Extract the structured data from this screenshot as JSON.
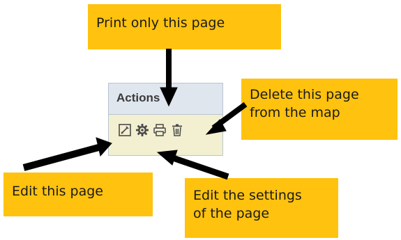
{
  "panel": {
    "header": "Actions",
    "icons": [
      "edit-page-icon",
      "settings-gear-icon",
      "print-icon",
      "trash-icon"
    ]
  },
  "callouts": {
    "print": "Print only this page",
    "delete_line1": "Delete this page",
    "delete_line2": "from the map",
    "edit": "Edit this page",
    "settings_line1": "Edit the settings",
    "settings_line2": "of the page"
  },
  "colors": {
    "callout_bg": "#ffc20e",
    "panel_header_bg": "#dfe6ee",
    "panel_body_bg": "#f3f0d1",
    "arrow": "#000000"
  }
}
